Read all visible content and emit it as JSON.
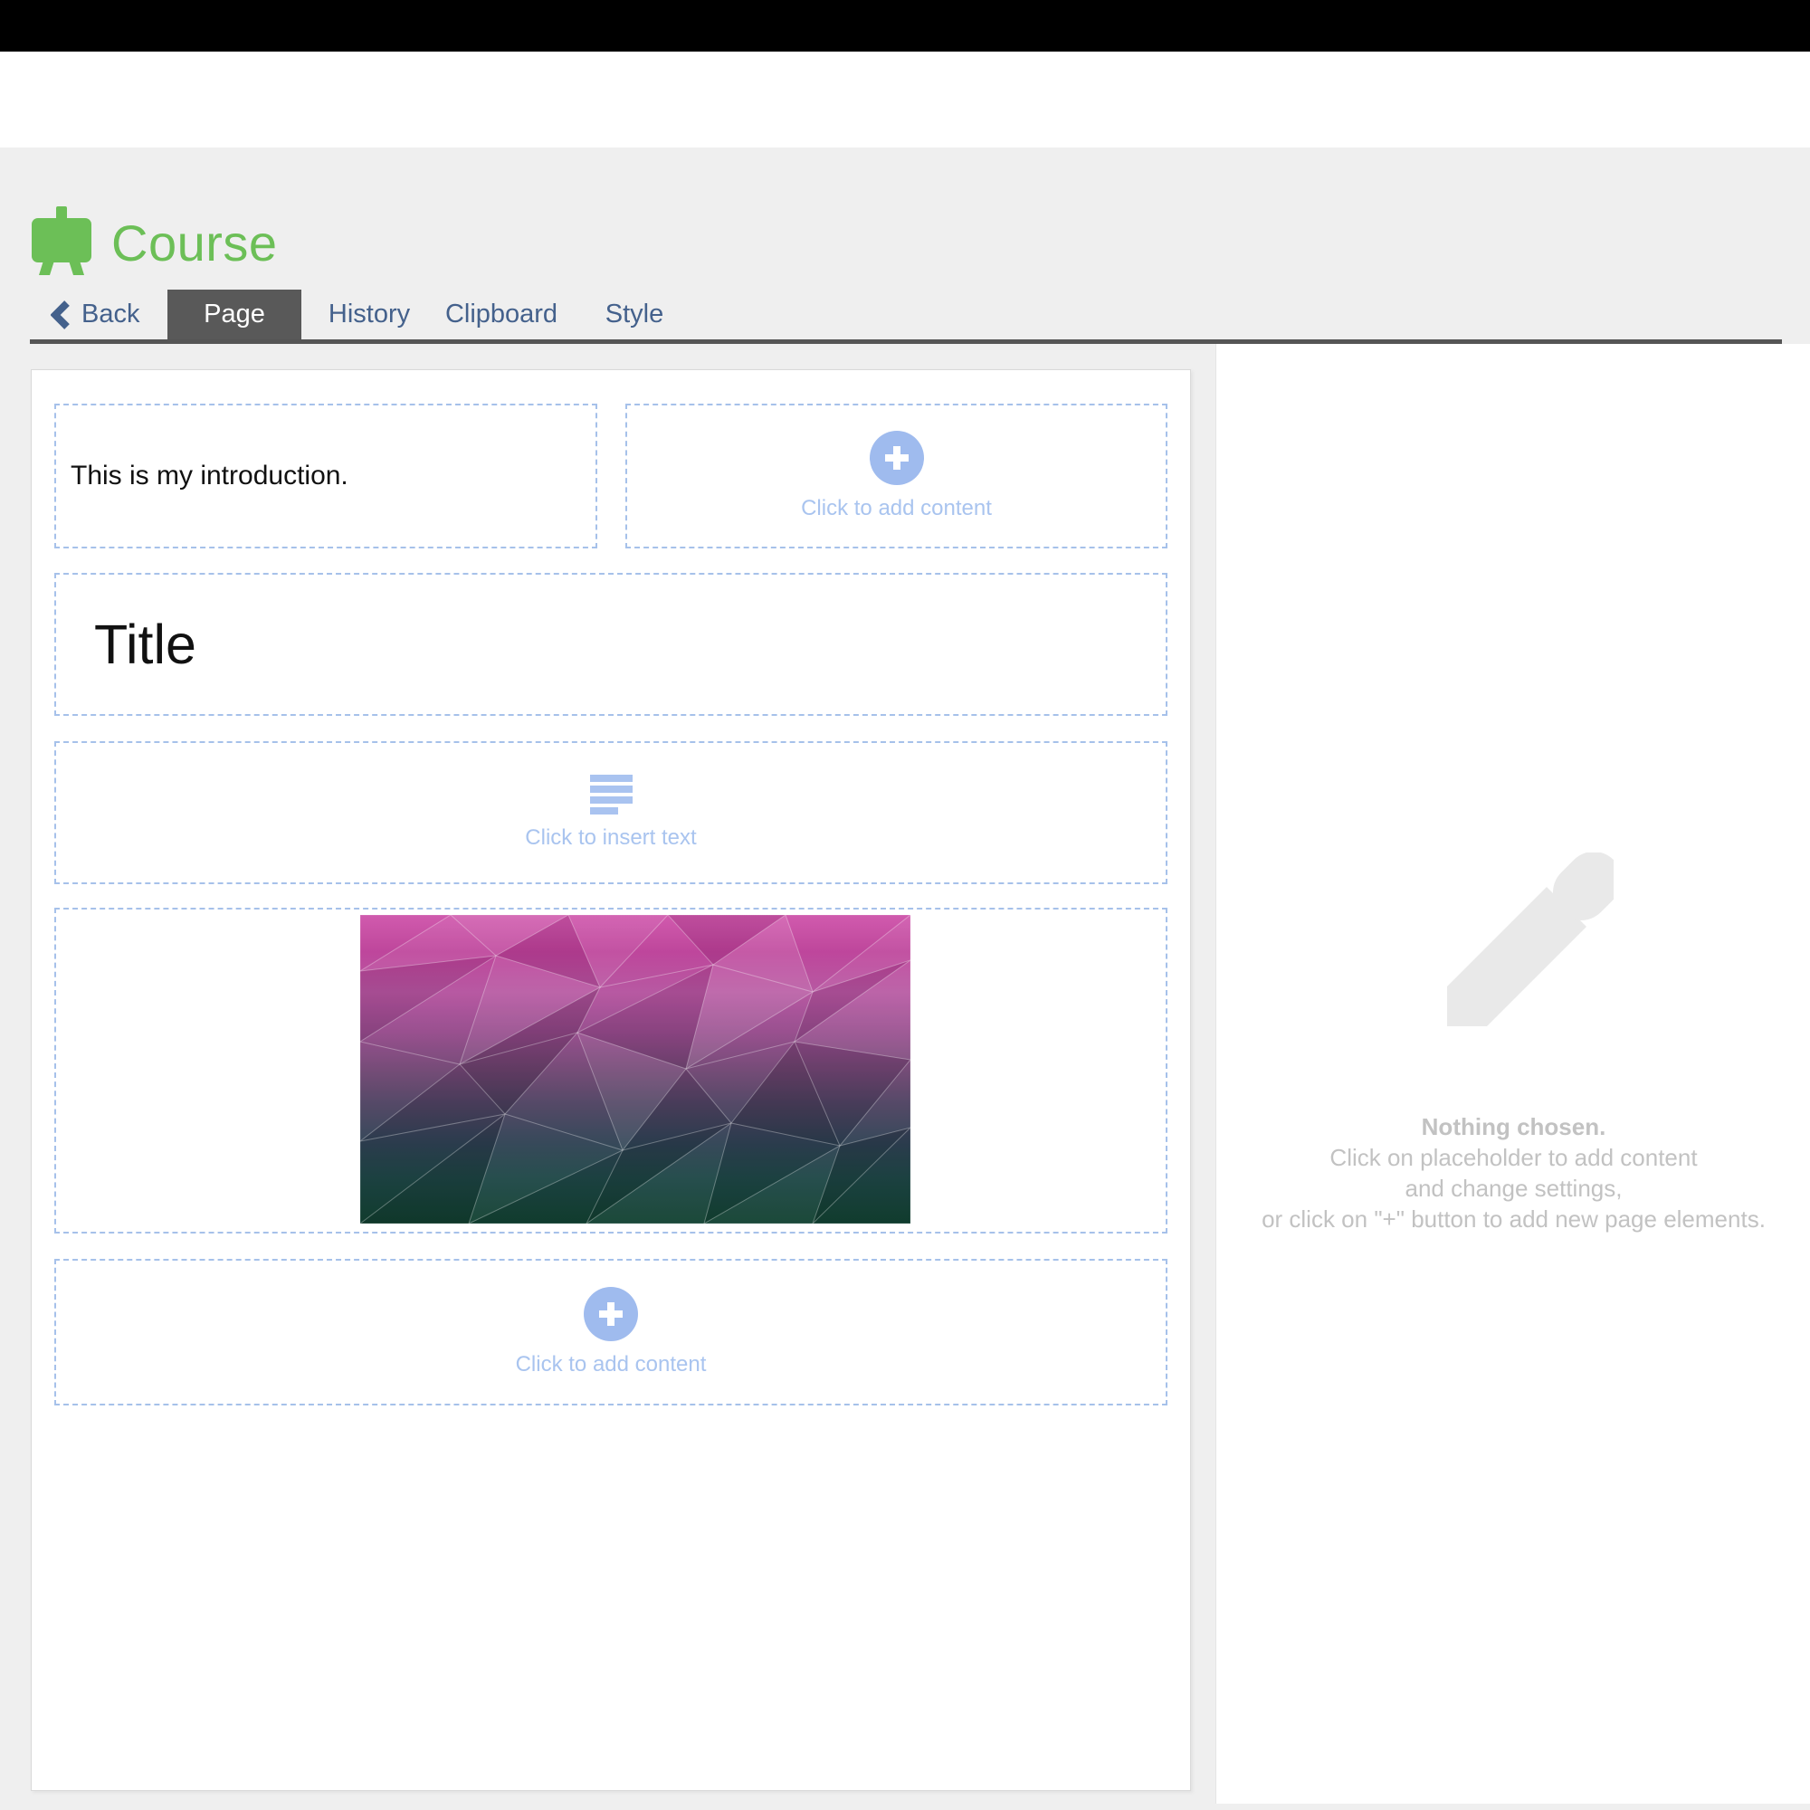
{
  "header": {
    "title": "Course"
  },
  "tabs": {
    "back_label": "Back",
    "items": [
      {
        "label": "Page",
        "active": true
      },
      {
        "label": "History",
        "active": false
      },
      {
        "label": "Clipboard",
        "active": false
      },
      {
        "label": "Style",
        "active": false
      }
    ]
  },
  "canvas": {
    "intro_text": "This is my introduction.",
    "title_text": "Title",
    "add_content_label": "Click to add content",
    "insert_text_label": "Click to insert text"
  },
  "inspector": {
    "nothing_chosen": "Nothing chosen.",
    "hint_line1": "Click on placeholder to add content",
    "hint_line2": "and change settings,",
    "hint_line3": "or click on \"+\" button to add new page elements."
  },
  "icons": {
    "easel": "easel-icon",
    "back_chevron": "chevron-left-icon",
    "plus": "plus-icon",
    "text_lines": "text-lines-icon",
    "pencil": "pencil-icon",
    "image": "low-poly-gradient-image"
  },
  "colors": {
    "accent_green": "#6cbf57",
    "tab_text_blue": "#44618c",
    "active_tab_bg": "#595959",
    "tab_underline": "#555555",
    "placeholder_circle_blue": "#9fbbee",
    "placeholder_text_blue": "#a9c4ef",
    "dashed_border_blue": "#a6c1ea",
    "page_background": "#efefef",
    "topbar_black": "#000000",
    "muted_gray_text": "#c2c2c2",
    "pencil_gray": "#e9e9e9"
  }
}
